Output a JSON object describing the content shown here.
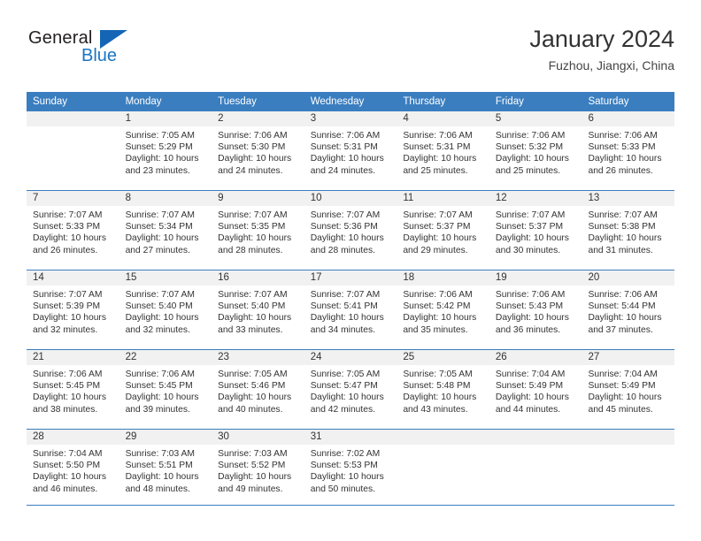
{
  "brand": {
    "name_part1": "General",
    "name_part2": "Blue",
    "triangle_icon": "triangle-icon",
    "primary_color": "#1a74c4"
  },
  "header": {
    "title": "January 2024",
    "subtitle": "Fuzhou, Jiangxi, China"
  },
  "calendar": {
    "header_color": "#3a7ec0",
    "weekdays": [
      "Sunday",
      "Monday",
      "Tuesday",
      "Wednesday",
      "Thursday",
      "Friday",
      "Saturday"
    ],
    "weeks": [
      [
        {
          "day": "",
          "sunrise": "",
          "sunset": "",
          "daylight": ""
        },
        {
          "day": "1",
          "sunrise": "Sunrise: 7:05 AM",
          "sunset": "Sunset: 5:29 PM",
          "daylight": "Daylight: 10 hours and 23 minutes."
        },
        {
          "day": "2",
          "sunrise": "Sunrise: 7:06 AM",
          "sunset": "Sunset: 5:30 PM",
          "daylight": "Daylight: 10 hours and 24 minutes."
        },
        {
          "day": "3",
          "sunrise": "Sunrise: 7:06 AM",
          "sunset": "Sunset: 5:31 PM",
          "daylight": "Daylight: 10 hours and 24 minutes."
        },
        {
          "day": "4",
          "sunrise": "Sunrise: 7:06 AM",
          "sunset": "Sunset: 5:31 PM",
          "daylight": "Daylight: 10 hours and 25 minutes."
        },
        {
          "day": "5",
          "sunrise": "Sunrise: 7:06 AM",
          "sunset": "Sunset: 5:32 PM",
          "daylight": "Daylight: 10 hours and 25 minutes."
        },
        {
          "day": "6",
          "sunrise": "Sunrise: 7:06 AM",
          "sunset": "Sunset: 5:33 PM",
          "daylight": "Daylight: 10 hours and 26 minutes."
        }
      ],
      [
        {
          "day": "7",
          "sunrise": "Sunrise: 7:07 AM",
          "sunset": "Sunset: 5:33 PM",
          "daylight": "Daylight: 10 hours and 26 minutes."
        },
        {
          "day": "8",
          "sunrise": "Sunrise: 7:07 AM",
          "sunset": "Sunset: 5:34 PM",
          "daylight": "Daylight: 10 hours and 27 minutes."
        },
        {
          "day": "9",
          "sunrise": "Sunrise: 7:07 AM",
          "sunset": "Sunset: 5:35 PM",
          "daylight": "Daylight: 10 hours and 28 minutes."
        },
        {
          "day": "10",
          "sunrise": "Sunrise: 7:07 AM",
          "sunset": "Sunset: 5:36 PM",
          "daylight": "Daylight: 10 hours and 28 minutes."
        },
        {
          "day": "11",
          "sunrise": "Sunrise: 7:07 AM",
          "sunset": "Sunset: 5:37 PM",
          "daylight": "Daylight: 10 hours and 29 minutes."
        },
        {
          "day": "12",
          "sunrise": "Sunrise: 7:07 AM",
          "sunset": "Sunset: 5:37 PM",
          "daylight": "Daylight: 10 hours and 30 minutes."
        },
        {
          "day": "13",
          "sunrise": "Sunrise: 7:07 AM",
          "sunset": "Sunset: 5:38 PM",
          "daylight": "Daylight: 10 hours and 31 minutes."
        }
      ],
      [
        {
          "day": "14",
          "sunrise": "Sunrise: 7:07 AM",
          "sunset": "Sunset: 5:39 PM",
          "daylight": "Daylight: 10 hours and 32 minutes."
        },
        {
          "day": "15",
          "sunrise": "Sunrise: 7:07 AM",
          "sunset": "Sunset: 5:40 PM",
          "daylight": "Daylight: 10 hours and 32 minutes."
        },
        {
          "day": "16",
          "sunrise": "Sunrise: 7:07 AM",
          "sunset": "Sunset: 5:40 PM",
          "daylight": "Daylight: 10 hours and 33 minutes."
        },
        {
          "day": "17",
          "sunrise": "Sunrise: 7:07 AM",
          "sunset": "Sunset: 5:41 PM",
          "daylight": "Daylight: 10 hours and 34 minutes."
        },
        {
          "day": "18",
          "sunrise": "Sunrise: 7:06 AM",
          "sunset": "Sunset: 5:42 PM",
          "daylight": "Daylight: 10 hours and 35 minutes."
        },
        {
          "day": "19",
          "sunrise": "Sunrise: 7:06 AM",
          "sunset": "Sunset: 5:43 PM",
          "daylight": "Daylight: 10 hours and 36 minutes."
        },
        {
          "day": "20",
          "sunrise": "Sunrise: 7:06 AM",
          "sunset": "Sunset: 5:44 PM",
          "daylight": "Daylight: 10 hours and 37 minutes."
        }
      ],
      [
        {
          "day": "21",
          "sunrise": "Sunrise: 7:06 AM",
          "sunset": "Sunset: 5:45 PM",
          "daylight": "Daylight: 10 hours and 38 minutes."
        },
        {
          "day": "22",
          "sunrise": "Sunrise: 7:06 AM",
          "sunset": "Sunset: 5:45 PM",
          "daylight": "Daylight: 10 hours and 39 minutes."
        },
        {
          "day": "23",
          "sunrise": "Sunrise: 7:05 AM",
          "sunset": "Sunset: 5:46 PM",
          "daylight": "Daylight: 10 hours and 40 minutes."
        },
        {
          "day": "24",
          "sunrise": "Sunrise: 7:05 AM",
          "sunset": "Sunset: 5:47 PM",
          "daylight": "Daylight: 10 hours and 42 minutes."
        },
        {
          "day": "25",
          "sunrise": "Sunrise: 7:05 AM",
          "sunset": "Sunset: 5:48 PM",
          "daylight": "Daylight: 10 hours and 43 minutes."
        },
        {
          "day": "26",
          "sunrise": "Sunrise: 7:04 AM",
          "sunset": "Sunset: 5:49 PM",
          "daylight": "Daylight: 10 hours and 44 minutes."
        },
        {
          "day": "27",
          "sunrise": "Sunrise: 7:04 AM",
          "sunset": "Sunset: 5:49 PM",
          "daylight": "Daylight: 10 hours and 45 minutes."
        }
      ],
      [
        {
          "day": "28",
          "sunrise": "Sunrise: 7:04 AM",
          "sunset": "Sunset: 5:50 PM",
          "daylight": "Daylight: 10 hours and 46 minutes."
        },
        {
          "day": "29",
          "sunrise": "Sunrise: 7:03 AM",
          "sunset": "Sunset: 5:51 PM",
          "daylight": "Daylight: 10 hours and 48 minutes."
        },
        {
          "day": "30",
          "sunrise": "Sunrise: 7:03 AM",
          "sunset": "Sunset: 5:52 PM",
          "daylight": "Daylight: 10 hours and 49 minutes."
        },
        {
          "day": "31",
          "sunrise": "Sunrise: 7:02 AM",
          "sunset": "Sunset: 5:53 PM",
          "daylight": "Daylight: 10 hours and 50 minutes."
        },
        {
          "day": "",
          "sunrise": "",
          "sunset": "",
          "daylight": ""
        },
        {
          "day": "",
          "sunrise": "",
          "sunset": "",
          "daylight": ""
        },
        {
          "day": "",
          "sunrise": "",
          "sunset": "",
          "daylight": ""
        }
      ]
    ]
  }
}
